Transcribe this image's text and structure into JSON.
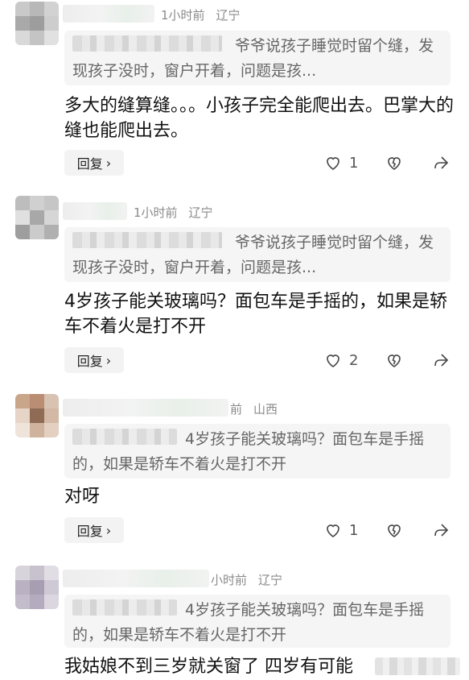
{
  "comments": [
    {
      "time": "1小时前",
      "location": "辽宁",
      "quote": "爷爷说孩子睡觉时留个缝，发现孩子没时，窗户开着，问题是孩...",
      "text": "多大的缝算缝。。。小孩子完全能爬出去。巴掌大的缝也能爬出去。",
      "reply_label": "回复",
      "likes": "1"
    },
    {
      "time": "1小时前",
      "location": "辽宁",
      "quote": "爷爷说孩子睡觉时留个缝，发现孩子没时，窗户开着，问题是孩...",
      "text": "4岁孩子能关玻璃吗？面包车是手摇的，如果是轿车不着火是打不开",
      "reply_label": "回复",
      "likes": "2"
    },
    {
      "time": "前",
      "location": "山西",
      "quote": "4岁孩子能关玻璃吗？面包车是手摇的，如果是轿车不着火是打不开",
      "text": "对呀",
      "reply_label": "回复",
      "likes": "1"
    },
    {
      "time": "小时前",
      "location": "辽宁",
      "quote": "4岁孩子能关玻璃吗？面包车是手摇的，如果是轿车不着火是打不开",
      "text": "我姑娘不到三岁就关窗了 四岁有可能"
    }
  ],
  "icons": {
    "like": "heart-outline-icon",
    "dislike": "broken-heart-icon",
    "share": "share-arrow-icon",
    "reply_chevron": "chevron-right-icon"
  }
}
